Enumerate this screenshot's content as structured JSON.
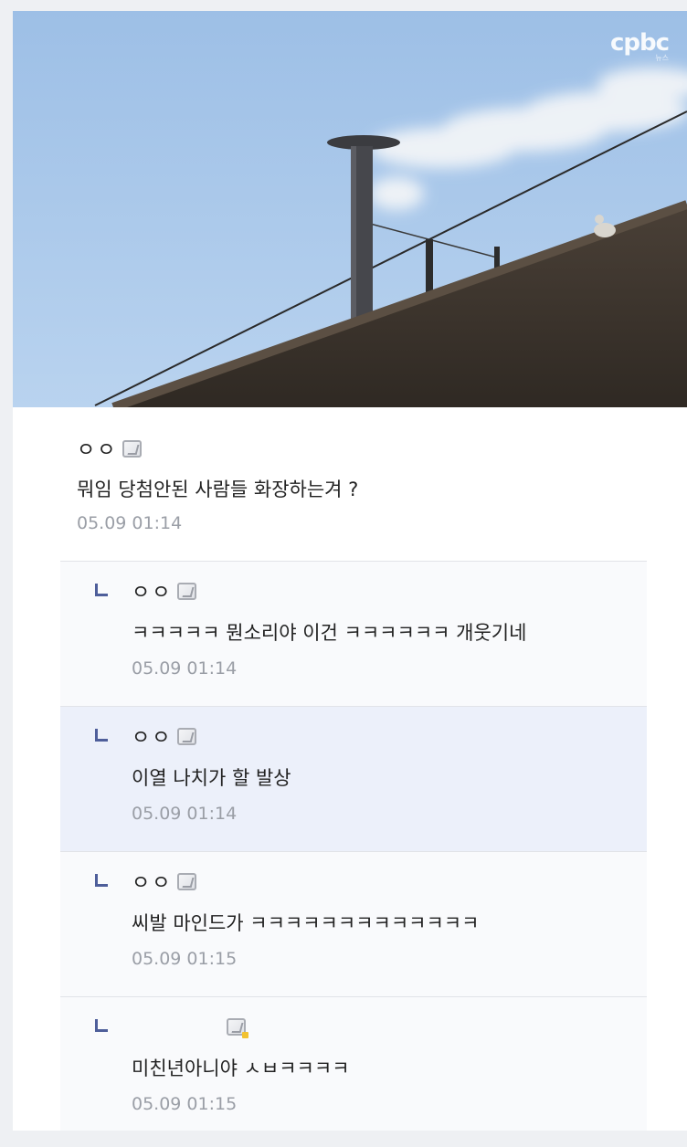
{
  "image": {
    "watermark": "cpbc",
    "watermark_sub": "뉴스"
  },
  "main_comment": {
    "nickname": "ㅇㅇ",
    "text": "뭐임 당첨안된 사람들 화장하는겨 ?",
    "time": "05.09 01:14"
  },
  "replies": [
    {
      "nickname": "ㅇㅇ",
      "text": "ㅋㅋㅋㅋㅋ 뭔소리야 이건 ㅋㅋㅋㅋㅋㅋ 개웃기네",
      "time": "05.09 01:14"
    },
    {
      "nickname": "ㅇㅇ",
      "text": "이열 나치가 할 발상",
      "time": "05.09 01:14"
    },
    {
      "nickname": "ㅇㅇ",
      "text": "씨발 마인드가 ㅋㅋㅋㅋㅋㅋㅋㅋㅋㅋㅋㅋㅋ",
      "time": "05.09 01:15"
    },
    {
      "nickname": "",
      "text": "미친년아니야 ㅅㅂㅋㅋㅋㅋ",
      "time": "05.09 01:15"
    }
  ],
  "colors": {
    "reply_mark": "#4e5e9a",
    "highlight_bg": "#ecf0fa",
    "time_text": "#9a9ea6"
  }
}
